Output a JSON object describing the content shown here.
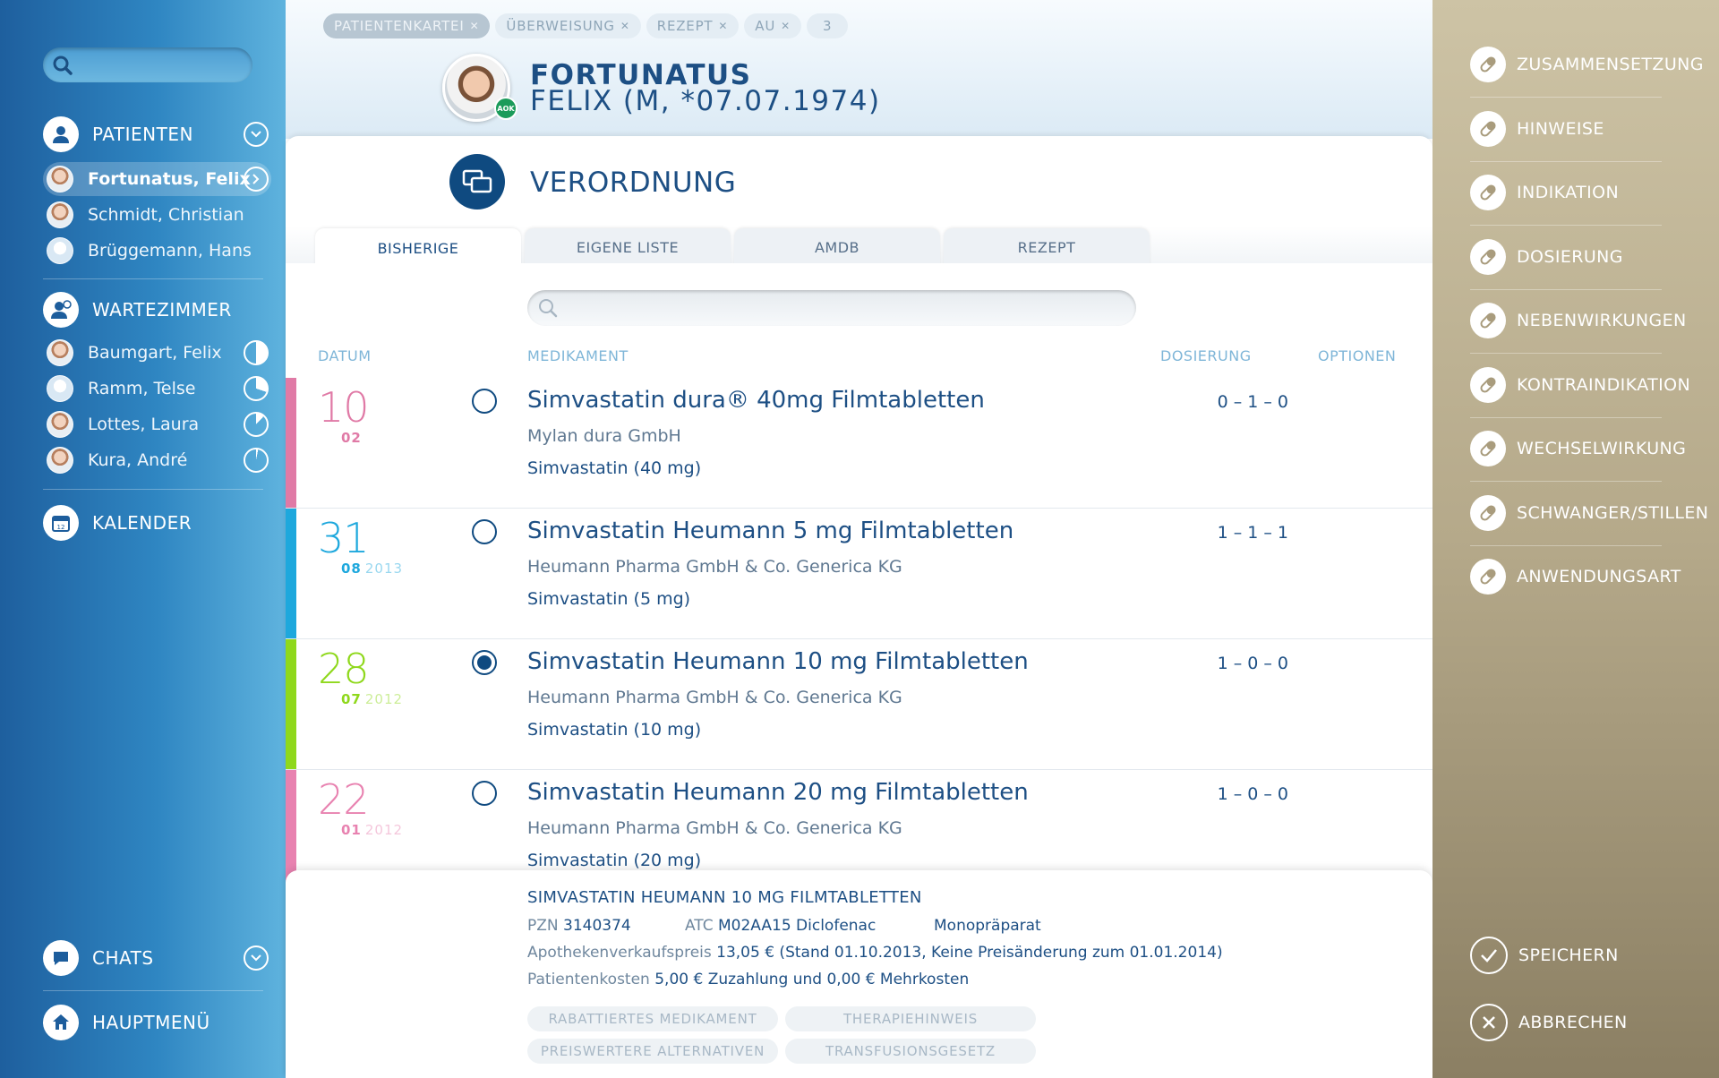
{
  "sidebar": {
    "patients_label": "PATIENTEN",
    "patients": [
      {
        "name": "Fortunatus, Felix",
        "active": true
      },
      {
        "name": "Schmidt, Christian"
      },
      {
        "name": "Brüggemann, Hans"
      }
    ],
    "waiting_label": "WARTEZIMMER",
    "waiting": [
      {
        "name": "Baumgart, Felix"
      },
      {
        "name": "Ramm, Telse"
      },
      {
        "name": "Lottes, Laura"
      },
      {
        "name": "Kura, André"
      }
    ],
    "calendar_label": "KALENDER",
    "chats_label": "CHATS",
    "menu_label": "HAUPTMENÜ"
  },
  "header": {
    "breadcrumbs": [
      {
        "label": "PATIENTENKARTEI"
      },
      {
        "label": "ÜBERWEISUNG"
      },
      {
        "label": "REZEPT"
      },
      {
        "label": "AU"
      },
      {
        "label": "3"
      }
    ],
    "patient_last": "FORTUNATUS",
    "patient_rest": "FELIX (M, *07.07.1974)",
    "insurer_badge": "AOK"
  },
  "main": {
    "section_title": "VERORDNUNG",
    "tabs": [
      {
        "label": "BISHERIGE"
      },
      {
        "label": "EIGENE LISTE"
      },
      {
        "label": "AMDB"
      },
      {
        "label": "REZEPT"
      }
    ],
    "columns": {
      "date": "DATUM",
      "med": "MEDIKAMENT",
      "dose": "DOSIERUNG",
      "options": "OPTIONEN"
    },
    "rows": [
      {
        "day": "10",
        "month": "02",
        "year": "",
        "color": "#e07aa6",
        "name": "Simvastatin dura® 40mg Filmtabletten",
        "maker": "Mylan dura GmbH",
        "ingredient": "Simvastatin (40 mg)",
        "dose": "0 – 1 – 0",
        "selected": false
      },
      {
        "day": "31",
        "month": "08",
        "year": "2013",
        "color": "#1ea8dd",
        "name": "Simvastatin Heumann 5 mg Filmtabletten",
        "maker": "Heumann Pharma GmbH & Co. Generica KG",
        "ingredient": "Simvastatin (5 mg)",
        "dose": "1 – 1 – 1",
        "selected": false
      },
      {
        "day": "28",
        "month": "07",
        "year": "2012",
        "color": "#8fd81c",
        "name": "Simvastatin Heumann 10 mg Filmtabletten",
        "maker": "Heumann Pharma GmbH & Co. Generica KG",
        "ingredient": "Simvastatin (10 mg)",
        "dose": "1 – 0 – 0",
        "selected": true
      },
      {
        "day": "22",
        "month": "01",
        "year": "2012",
        "color": "#e882b0",
        "name": "Simvastatin Heumann 20 mg Filmtabletten",
        "maker": "Heumann Pharma GmbH & Co. Generica KG",
        "ingredient": "Simvastatin (20 mg)",
        "dose": "1 – 0 – 0",
        "selected": false
      }
    ]
  },
  "detail": {
    "title": "SIMVASTATIN HEUMANN 10 MG FILMTABLETTEN",
    "pzn_label": "PZN",
    "pzn": "3140374",
    "atc_label": "ATC",
    "atc": "M02AA15 Diclofenac",
    "type": "Monopräparat",
    "price_label": "Apothekenverkaufspreis",
    "price": "13,05 € (Stand 01.10.2013, Keine Preisänderung zum 01.01.2014)",
    "cost_label": "Patientenkosten",
    "cost": "5,00 € Zuzahlung und 0,00 € Mehrkosten",
    "chips": [
      "RABATTIERTES MEDIKAMENT",
      "THERAPIEHINWEIS",
      "PREISWERTERE ALTERNATIVEN",
      "TRANSFUSIONSGESETZ"
    ]
  },
  "rightbar": {
    "items": [
      {
        "label": "ZUSAMMENSETZUNG"
      },
      {
        "label": "HINWEISE"
      },
      {
        "label": "INDIKATION"
      },
      {
        "label": "DOSIERUNG"
      },
      {
        "label": "NEBENWIRKUNGEN"
      },
      {
        "label": "KONTRAINDIKATION"
      },
      {
        "label": "WECHSELWIRKUNG"
      },
      {
        "label": "SCHWANGER/STILLEN"
      },
      {
        "label": "ANWENDUNGSART"
      }
    ],
    "save_label": "SPEICHERN",
    "cancel_label": "ABBRECHEN"
  }
}
